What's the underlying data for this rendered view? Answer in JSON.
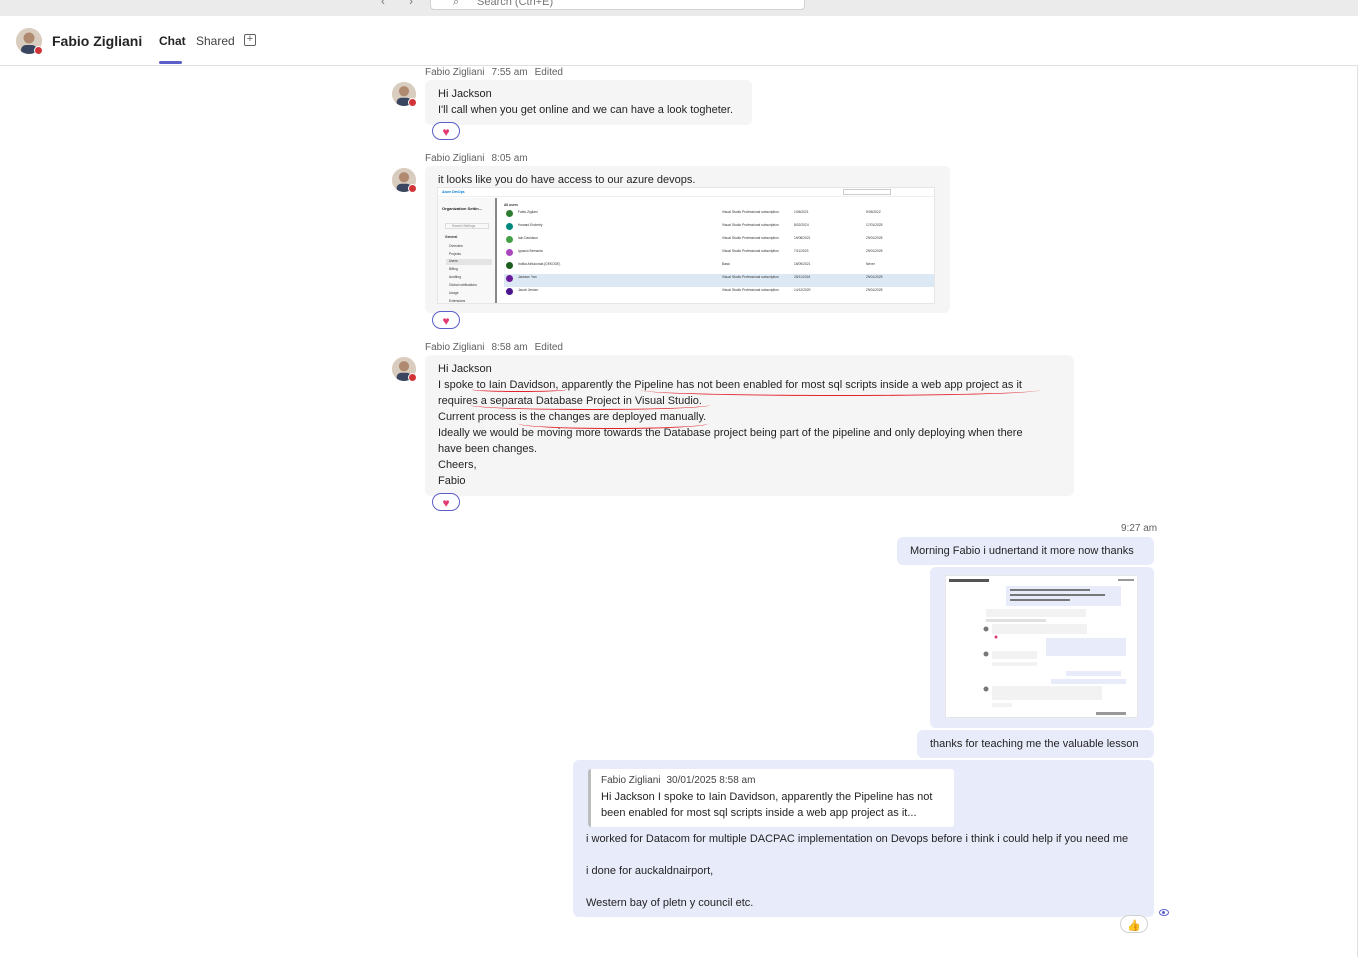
{
  "topbar": {
    "search_placeholder": "Search (Ctrl+E)"
  },
  "header": {
    "name": "Fabio Zigliani",
    "tabs": [
      "Chat",
      "Shared"
    ]
  },
  "messages": [
    {
      "sender": "Fabio Zigliani",
      "time": "7:55 am",
      "edited": "Edited",
      "lines": [
        "Hi Jackson",
        "I'll call when you get online and we can have a look togheter."
      ]
    },
    {
      "sender": "Fabio Zigliani",
      "time": "8:05 am",
      "lines": [
        "it looks like you do have access  to our azure devops."
      ]
    },
    {
      "sender": "Fabio Zigliani",
      "time": "8:58 am",
      "edited": "Edited",
      "lines": [
        "Hi Jackson",
        "I spoke to Iain Davidson, apparently the Pipeline has not been enabled for most sql scripts inside a web app project as it",
        "requires a separata Database Project in Visual Studio.",
        "Current process is the changes are deployed manually.",
        "Ideally we would be moving more towards the Database project being part of the pipeline and only deploying when there",
        "have been changes.",
        "Cheers,",
        "Fabio"
      ]
    }
  ],
  "screenshot_devops": {
    "brand": "Azure DevOps",
    "panel_title": "Organization Settin...",
    "search_settings": "Search Settings",
    "section": "General",
    "nav": [
      "Overview",
      "Projects",
      "Users",
      "Billing",
      "Auditing",
      "Global notifications",
      "Usage",
      "Extensions"
    ],
    "all_users": "All users",
    "rows": [
      {
        "name": "Fabio Zigliani",
        "access": "Visual Studio Professional subscription",
        "d1": "1/06/2021",
        "d2": "9/06/2022"
      },
      {
        "name": "Howard Enderby",
        "access": "Visual Studio Professional subscription",
        "d1": "8/02/2024",
        "d2": "17/01/2025"
      },
      {
        "name": "Iain Davidson",
        "access": "Visual Studio Professional subscription",
        "d1": "19/08/2021",
        "d2": "29/01/2025"
      },
      {
        "name": "Ignacio Bernardo",
        "access": "Visual Studio Professional subscription",
        "d1": "7/11/2023",
        "d2": "29/01/2025"
      },
      {
        "name": "Indika Athukorala (DEKODE)",
        "access": "Basic",
        "d1": "18/09/2021",
        "d2": "Never"
      },
      {
        "name": "Jackson Yan",
        "access": "Visual Studio Professional subscription",
        "d1": "28/11/2024",
        "d2": "29/01/2025"
      },
      {
        "name": "Jacob Jensen",
        "access": "Visual Studio Professional subscription",
        "d1": "14/12/2020",
        "d2": "29/01/2025"
      }
    ]
  },
  "outgoing": {
    "time": "9:27 am",
    "msg1": "Morning Fabio i udnertand it more now thanks",
    "msg2": "thanks for teaching me the valuable lesson",
    "quote": {
      "sender": "Fabio Zigliani",
      "datetime": "30/01/2025 8:58 am",
      "lines": [
        "Hi Jackson I spoke to Iain Davidson, apparently the Pipeline has not",
        "been enabled for most sql scripts inside a web app project as it..."
      ]
    },
    "reply_lines": [
      "i worked for Datacom for multiple DACPAC implementation on Devops before i think i could help if you need me",
      "",
      "i done for auckaldnairport,",
      "",
      "Western bay of pletn y council etc."
    ]
  },
  "colors": {
    "accent": "#5b5fc7",
    "outgoing_bubble": "#e8ebfa",
    "incoming_bubble": "#f5f5f5",
    "presence_busy": "#d13438",
    "annotation_red": "#e2222a"
  }
}
